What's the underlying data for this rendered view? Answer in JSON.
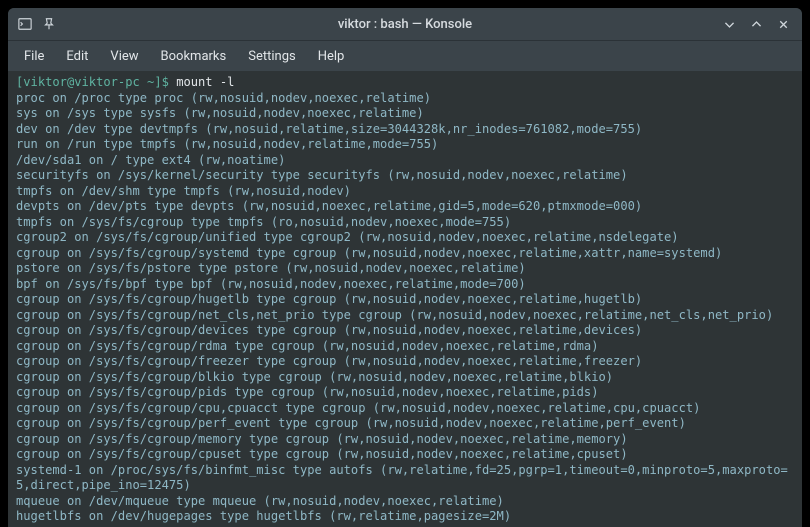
{
  "window": {
    "title": "viktor : bash — Konsole",
    "icons": {
      "app": "terminal-icon",
      "pin": "pin-icon",
      "min": "minimize-icon",
      "max": "maximize-icon",
      "close": "close-icon"
    },
    "controls": {
      "minimize_glyph": "⌄",
      "maximize_glyph": "⌃",
      "close_glyph": "✕"
    }
  },
  "menubar": {
    "items": [
      "File",
      "Edit",
      "View",
      "Bookmarks",
      "Settings",
      "Help"
    ]
  },
  "prompt": {
    "bracket_text": "[viktor@viktor-pc ~]$",
    "command": "mount -l"
  },
  "mount_output": [
    "proc on /proc type proc (rw,nosuid,nodev,noexec,relatime)",
    "sys on /sys type sysfs (rw,nosuid,nodev,noexec,relatime)",
    "dev on /dev type devtmpfs (rw,nosuid,relatime,size=3044328k,nr_inodes=761082,mode=755)",
    "run on /run type tmpfs (rw,nosuid,nodev,relatime,mode=755)",
    "/dev/sda1 on / type ext4 (rw,noatime)",
    "securityfs on /sys/kernel/security type securityfs (rw,nosuid,nodev,noexec,relatime)",
    "tmpfs on /dev/shm type tmpfs (rw,nosuid,nodev)",
    "devpts on /dev/pts type devpts (rw,nosuid,noexec,relatime,gid=5,mode=620,ptmxmode=000)",
    "tmpfs on /sys/fs/cgroup type tmpfs (ro,nosuid,nodev,noexec,mode=755)",
    "cgroup2 on /sys/fs/cgroup/unified type cgroup2 (rw,nosuid,nodev,noexec,relatime,nsdelegate)",
    "cgroup on /sys/fs/cgroup/systemd type cgroup (rw,nosuid,nodev,noexec,relatime,xattr,name=systemd)",
    "pstore on /sys/fs/pstore type pstore (rw,nosuid,nodev,noexec,relatime)",
    "bpf on /sys/fs/bpf type bpf (rw,nosuid,nodev,noexec,relatime,mode=700)",
    "cgroup on /sys/fs/cgroup/hugetlb type cgroup (rw,nosuid,nodev,noexec,relatime,hugetlb)",
    "cgroup on /sys/fs/cgroup/net_cls,net_prio type cgroup (rw,nosuid,nodev,noexec,relatime,net_cls,net_prio)",
    "cgroup on /sys/fs/cgroup/devices type cgroup (rw,nosuid,nodev,noexec,relatime,devices)",
    "cgroup on /sys/fs/cgroup/rdma type cgroup (rw,nosuid,nodev,noexec,relatime,rdma)",
    "cgroup on /sys/fs/cgroup/freezer type cgroup (rw,nosuid,nodev,noexec,relatime,freezer)",
    "cgroup on /sys/fs/cgroup/blkio type cgroup (rw,nosuid,nodev,noexec,relatime,blkio)",
    "cgroup on /sys/fs/cgroup/pids type cgroup (rw,nosuid,nodev,noexec,relatime,pids)",
    "cgroup on /sys/fs/cgroup/cpu,cpuacct type cgroup (rw,nosuid,nodev,noexec,relatime,cpu,cpuacct)",
    "cgroup on /sys/fs/cgroup/perf_event type cgroup (rw,nosuid,nodev,noexec,relatime,perf_event)",
    "cgroup on /sys/fs/cgroup/memory type cgroup (rw,nosuid,nodev,noexec,relatime,memory)",
    "cgroup on /sys/fs/cgroup/cpuset type cgroup (rw,nosuid,nodev,noexec,relatime,cpuset)",
    "systemd-1 on /proc/sys/fs/binfmt_misc type autofs (rw,relatime,fd=25,pgrp=1,timeout=0,minproto=5,maxproto=5,direct,pipe_ino=12475)",
    "mqueue on /dev/mqueue type mqueue (rw,nosuid,nodev,noexec,relatime)",
    "hugetlbfs on /dev/hugepages type hugetlbfs (rw,relatime,pagesize=2M)"
  ]
}
